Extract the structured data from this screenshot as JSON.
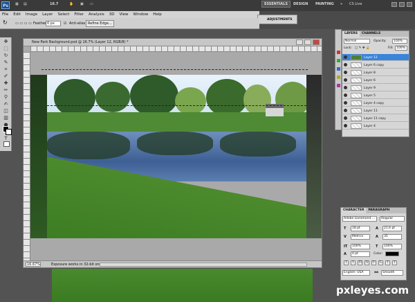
{
  "app": {
    "logo": "Ps",
    "zoom_control": "16.7",
    "workspaces": [
      "ESSENTIALS",
      "DESIGN",
      "PAINTING"
    ],
    "more": "»",
    "cs_live": "CS Live"
  },
  "menu": [
    "File",
    "Edit",
    "Image",
    "Layer",
    "Select",
    "Filter",
    "Analysis",
    "3D",
    "View",
    "Window",
    "Help"
  ],
  "options": {
    "feather_label": "Feather:",
    "feather_value": "0 px",
    "antialias_label": "Anti-alias",
    "refine_edge": "Refine Edge..."
  },
  "adjustments_tab": "ADJUSTMENTS",
  "document": {
    "title": "New Park Background.psd @ 16.7% (Layer 12, RGB/8) *",
    "zoom": "16.67%",
    "status": "Exposure works in 32-bit only"
  },
  "layers_panel": {
    "tabs": [
      "LAYERS",
      "CHANNELS"
    ],
    "blend_mode": "Normal",
    "opacity_label": "Opacity:",
    "opacity_value": "100%",
    "lock_label": "Lock:",
    "fill_label": "Fill:",
    "fill_value": "100%",
    "layers": [
      "Layer 12",
      "Layer 6 copy",
      "Layer 8",
      "Layer 6",
      "Layer 9",
      "Layer 5",
      "Layer 4 copy",
      "Layer 11",
      "Layer 11 copy",
      "Layer 4"
    ],
    "selected_index": 0
  },
  "character_panel": {
    "tabs": [
      "CHARACTER",
      "PARAGRAPH"
    ],
    "font_family": "Adobe Garamond ...",
    "font_style": "Regular",
    "font_size": "18 pt",
    "leading": "21.6 pt",
    "kerning": "Metrics",
    "tracking": "35",
    "vertical_scale": "100%",
    "horizontal_scale": "100%",
    "baseline_shift": "0 pt",
    "color_label": "Color:",
    "format_buttons": [
      "T",
      "T",
      "TT",
      "Tr",
      "T¹",
      "T₁",
      "T",
      "T"
    ],
    "language": "English: USA",
    "aa_label": "aa",
    "antialias": "Smooth"
  },
  "watermark": "pxleyes.com",
  "colors": {
    "selected_layer": "#3a84d9",
    "accent": "#1b4f8a"
  }
}
